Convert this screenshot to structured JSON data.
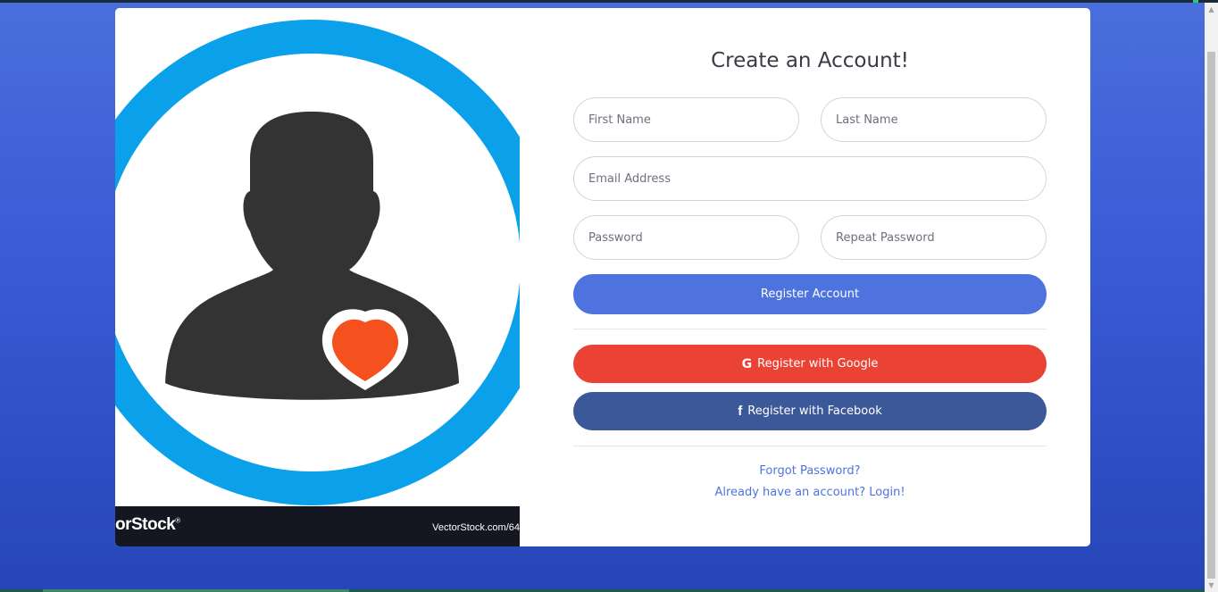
{
  "page": {
    "title": "Create an Account!"
  },
  "image": {
    "brand": "orStock",
    "brand_mark": "®",
    "url": "VectorStock.com/64",
    "colors": {
      "ring": "#0aa1ea",
      "silhouette": "#333333",
      "heart": "#f4511e"
    }
  },
  "form": {
    "first_name": {
      "placeholder": "First Name",
      "value": ""
    },
    "last_name": {
      "placeholder": "Last Name",
      "value": ""
    },
    "email": {
      "placeholder": "Email Address",
      "value": ""
    },
    "password": {
      "placeholder": "Password",
      "value": ""
    },
    "repeat_password": {
      "placeholder": "Repeat Password",
      "value": ""
    },
    "register_button": "Register Account",
    "google_button": "Register with Google",
    "google_icon": "G",
    "facebook_button": "Register with Facebook",
    "facebook_icon": "f",
    "forgot_password": "Forgot Password?",
    "login_link": "Already have an account? Login!"
  },
  "colors": {
    "primary": "#4e73df",
    "google": "#ea4335",
    "facebook": "#3b5998",
    "background": "#4a6fdc"
  }
}
